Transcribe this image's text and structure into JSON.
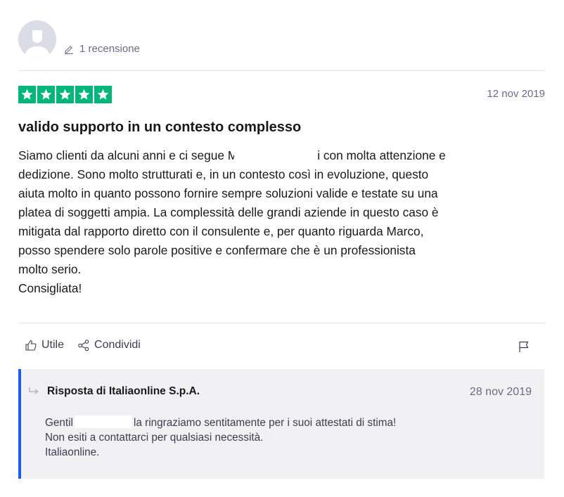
{
  "reviewer": {
    "review_count": "1 recensione"
  },
  "review": {
    "rating": 5,
    "rating_max": 5,
    "date": "12 nov 2019",
    "title": "valido supporto in un contesto complesso",
    "body_lines": [
      [
        "Siamo clienti da alcuni anni e ci segue M",
        "i con molta attenzione e"
      ],
      "dedizione. Sono molto strutturati e, in un contesto così in evoluzione, questo",
      "aiuta molto in quanto possono fornire sempre soluzioni valide e testate su una",
      "platea di soggetti ampia. La complessità delle grandi aziende in questo caso è",
      "mitigata dal rapporto diretto con il consulente e, per quanto riguarda Marco,",
      "posso spendere solo parole positive e confermare che è un professionista",
      "molto serio.",
      "Consigliata!"
    ]
  },
  "actions": {
    "useful_label": "Utile",
    "share_label": "Condividi"
  },
  "reply": {
    "title": "Risposta di Italiaonline S.p.A.",
    "date": "28 nov 2019",
    "lines": [
      [
        "Gentil",
        "la ringraziamo sentitamente per i suoi attestati di stima!"
      ],
      "Non esiti a contattarci per qualsiasi necessità.",
      "Italiaonline."
    ]
  },
  "colors": {
    "star_green": "#00b67a",
    "reply_accent": "#1c5bff",
    "muted_text": "#6b6b83"
  }
}
